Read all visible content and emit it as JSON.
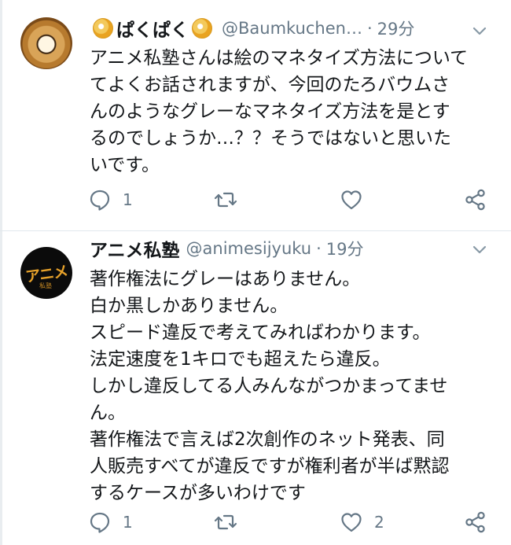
{
  "tweets": [
    {
      "name": "ぱくぱく",
      "handle": "@Baumkuchen…",
      "separator": "·",
      "time": "29分",
      "text": "アニメ私塾さんは絵のマネタイズ方法について\nてよくお話されますが、今回のたろバウムさ\nんのようなグレーなマネタイズ方法を是とす\nるのでしょうか…？？そうではないと思いた\nいです。",
      "reply_count": "1",
      "retweet_count": "",
      "like_count": ""
    },
    {
      "name": "アニメ私塾",
      "handle": "@animesijyuku",
      "separator": "·",
      "time": "19分",
      "text": "著作権法にグレーはありません。\n白か黒しかありません。\nスピード違反で考えてみればわかります。\n法定速度を1キロでも超えたら違反。\nしかし違反してる人みんながつかまってませ\nん。\n著作権法で言えば2次創作のネット発表、同\n人販売すべてが違反ですが権利者が半ば黙認\nするケースが多いわけです",
      "reply_count": "1",
      "retweet_count": "",
      "like_count": "2"
    }
  ],
  "avatar_2_mark": "アニメ",
  "avatar_2_sub": "私塾",
  "icons": {
    "reply": "reply-icon",
    "retweet": "retweet-icon",
    "like": "like-icon",
    "share": "share-icon",
    "menu": "chevron-down-icon",
    "emoji": "cd-emoji-icon"
  },
  "colors": {
    "text": "#14171a",
    "secondary": "#657786",
    "divider": "#e1e8ed"
  }
}
